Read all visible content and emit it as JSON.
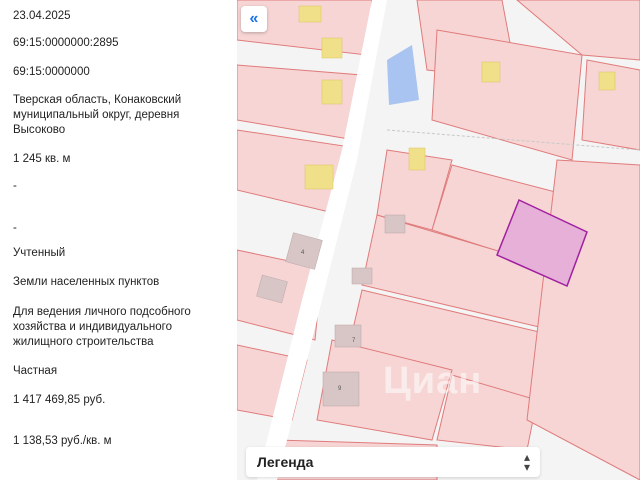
{
  "info": {
    "date": "23.04.2025",
    "cadastral_number": "69:15:0000000:2895",
    "cadastral_quarter": "69:15:0000000",
    "address": "Тверская область, Конаковский муниципальный округ, деревня Высоково",
    "area": "1 245 кв. м",
    "dash1": "-",
    "dash2": "-",
    "status": "Учтенный",
    "category": "Земли населенных пунктов",
    "permitted_use": "Для ведения личного подсобного хозяйства и индивидуального жилищного строительства",
    "ownership": "Частная",
    "cadastral_value": "1 417 469,85 руб.",
    "value_per_sqm": "1 138,53 руб./кв. м"
  },
  "map": {
    "collapse_icon": "«",
    "legend_label": "Легенда",
    "legend_icon": "chevron-up-down-icon",
    "house_numbers": [
      "4",
      "7",
      "9"
    ],
    "watermark": "Циан",
    "colors": {
      "parcel_fill": "#f7d5d5",
      "parcel_stroke": "#e07b7b",
      "selected_fill": "#e6b0d8",
      "selected_stroke": "#a020a0",
      "building_fill": "#f0e08a",
      "water_fill": "#a9c4f0",
      "road": "#ffffff"
    }
  }
}
